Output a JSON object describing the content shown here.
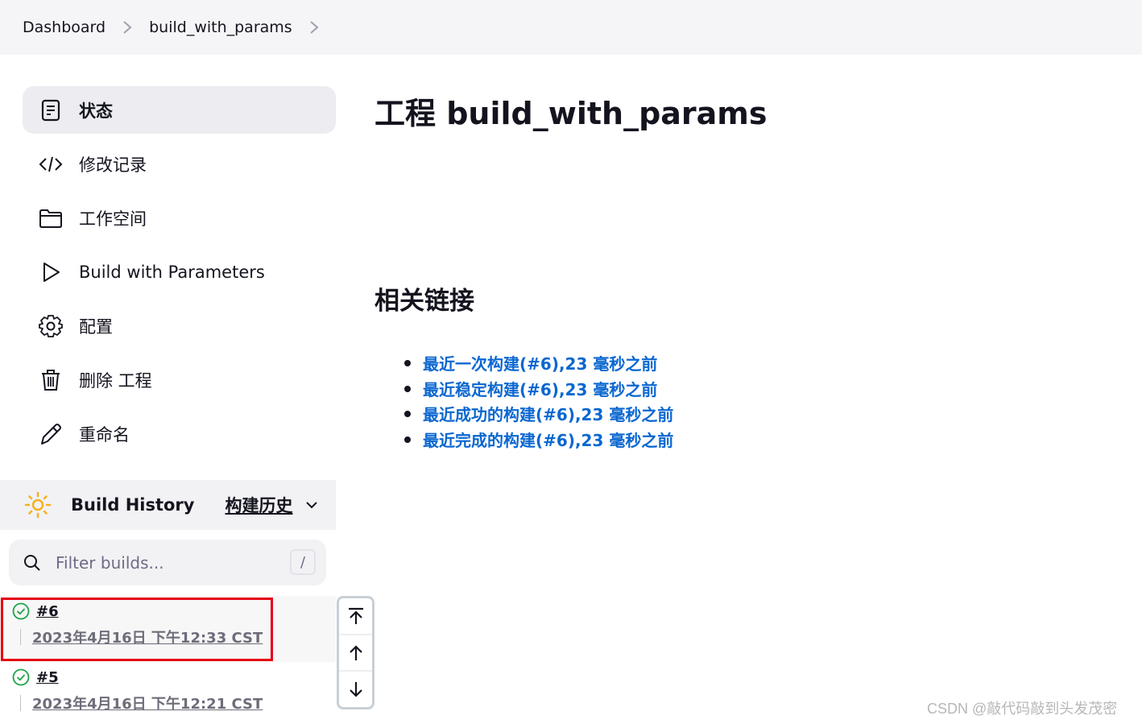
{
  "breadcrumb": {
    "items": [
      "Dashboard",
      "build_with_params"
    ]
  },
  "sidebar": {
    "items": [
      {
        "label": "状态",
        "icon": "document-icon",
        "active": true
      },
      {
        "label": "修改记录",
        "icon": "code-icon"
      },
      {
        "label": "工作空间",
        "icon": "folder-icon"
      },
      {
        "label": "Build with Parameters",
        "icon": "play-icon"
      },
      {
        "label": "配置",
        "icon": "gear-icon"
      },
      {
        "label": "删除 工程",
        "icon": "trash-icon"
      },
      {
        "label": "重命名",
        "icon": "pencil-icon"
      }
    ]
  },
  "build_history": {
    "title": "Build History",
    "title_cn": "构建历史",
    "filter_placeholder": "Filter builds...",
    "shortcut_key": "/",
    "builds": [
      {
        "number": "#6",
        "date": "2023年4月16日 下午12:33 CST",
        "status": "success",
        "highlighted": true
      },
      {
        "number": "#5",
        "date": "2023年4月16日 下午12:21 CST",
        "status": "success"
      }
    ]
  },
  "main": {
    "title": "工程 build_with_params",
    "related_links_title": "相关链接",
    "links": [
      "最近一次构建(#6),23 毫秒之前",
      "最近稳定构建(#6),23 毫秒之前",
      "最近成功的构建(#6),23 毫秒之前",
      "最近完成的构建(#6),23 毫秒之前"
    ]
  },
  "colors": {
    "link": "#0b67d0",
    "success": "#1ea446",
    "sun": "#f6b01a",
    "highlight_border": "#e60012"
  },
  "watermark": "CSDN @敲代码敲到头发茂密"
}
